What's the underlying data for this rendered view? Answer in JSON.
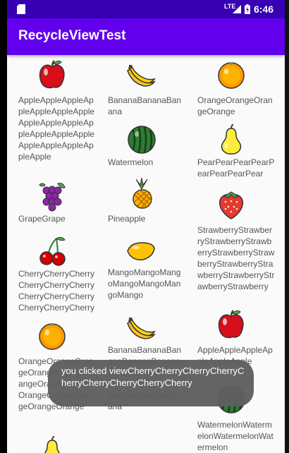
{
  "status_bar": {
    "time": "6:46",
    "network": "LTE"
  },
  "app_bar": {
    "title": "RecycleViewTest"
  },
  "fruits": [
    {
      "name": "AppleAppleAppleAppleAppleAppleAppleAppleAppleAppleAppleAppleAppleAppleAppleAppleAppleAppleApple",
      "icon": "apple-icon"
    },
    {
      "name": "BananaBananaBanana",
      "icon": "banana-icon"
    },
    {
      "name": "OrangeOrangeOrangeOrange",
      "icon": "orange-icon"
    },
    {
      "name": "Watermelon",
      "icon": "watermelon-icon"
    },
    {
      "name": "PearPearPearPearPearPearPearPear",
      "icon": "pear-icon"
    },
    {
      "name": "GrapeGrape",
      "icon": "grape-icon"
    },
    {
      "name": "Pineapple",
      "icon": "pineapple-icon"
    },
    {
      "name": "StrawberryStrawberryStrawberryStrawberryStrawberryStrawberryStrawberryStrawberryStrawberryStrawberryStrawberry",
      "icon": "strawberry-icon"
    },
    {
      "name": "CherryCherryCherryCherryCherryCherryCherryCherryCherryCherryCherryCherry",
      "icon": "cherry-icon"
    },
    {
      "name": "MangoMangoMangoMangoMangoMangoMango",
      "icon": "mango-icon"
    },
    {
      "name": "OrangeOrangeOrangeOrangeOrangeOrangeOrangeOrangeOrangeOrangeOrangeOrangeOrange",
      "icon": "orange-icon"
    },
    {
      "name": "BananaBananaBananaBananaBananaBananaBananaBananaBananaBananaBananaBananaBanana",
      "icon": "banana-icon"
    },
    {
      "name": "AppleAppleAppleAppleAppleApple",
      "icon": "apple-icon"
    },
    {
      "name": "WatermelonWatermelonWatermelonWatermelon",
      "icon": "watermelon-icon"
    },
    {
      "name": "",
      "icon": "pear-icon"
    }
  ],
  "toast": {
    "message": "you clicked viewCherryCherryCherryCherryCherryCherryCherryCherryCherry"
  }
}
